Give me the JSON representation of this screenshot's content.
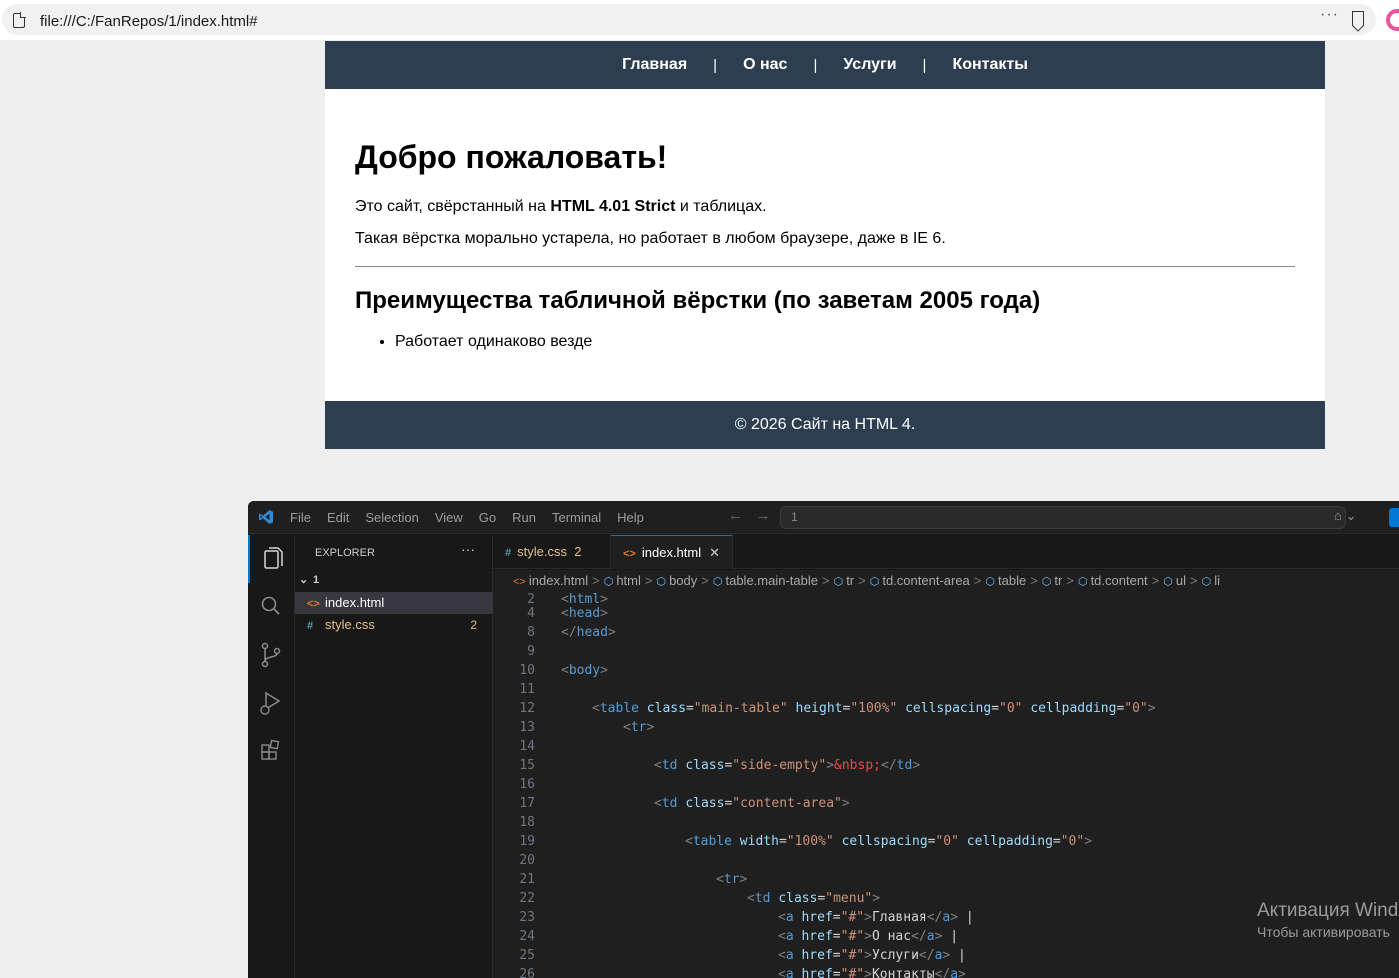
{
  "browser": {
    "url": "file:///C:/FanRepos/1/index.html#"
  },
  "site": {
    "menu": [
      "Главная",
      "О нас",
      "Услуги",
      "Контакты"
    ],
    "menu_sep": "|",
    "heading": "Добро пожаловать!",
    "p1_before": "Это сайт, свёрстанный на ",
    "p1_bold": "HTML 4.01 Strict",
    "p1_after": " и таблицах.",
    "p2": "Такая вёрстка морально устарела, но работает в любом браузере, даже в IE 6.",
    "subheading": "Преимущества табличной вёрстки (по заветам 2005 года)",
    "list": [
      "Работает одинаково везде"
    ],
    "footer": "© 2026 Сайт на HTML 4."
  },
  "vscode": {
    "menus": [
      "File",
      "Edit",
      "Selection",
      "View",
      "Go",
      "Run",
      "Terminal",
      "Help"
    ],
    "command_center": "1",
    "explorer_title": "EXPLORER",
    "folder": "1",
    "files": [
      {
        "name": "index.html",
        "icon": "<>",
        "selected": true,
        "badge": ""
      },
      {
        "name": "style.css",
        "icon": "#",
        "selected": false,
        "badge": "2"
      }
    ],
    "tabs": [
      {
        "name": "style.css",
        "icon": "#",
        "badge": "2",
        "active": false
      },
      {
        "name": "index.html",
        "icon": "<>",
        "active": true
      }
    ],
    "breadcrumbs": [
      "index.html",
      "html",
      "body",
      "table.main-table",
      "tr",
      "td.content-area",
      "table",
      "tr",
      "td.content",
      "ul",
      "li"
    ],
    "code_lines": [
      {
        "n": "2",
        "indent": 0,
        "parts": [
          [
            "br",
            "<"
          ],
          [
            "tag",
            "html"
          ],
          [
            "br",
            ">"
          ]
        ]
      },
      {
        "n": "4",
        "indent": 0,
        "parts": [
          [
            "br",
            "<"
          ],
          [
            "tag",
            "head"
          ],
          [
            "br",
            ">"
          ]
        ]
      },
      {
        "n": "8",
        "indent": 0,
        "parts": [
          [
            "br",
            "</"
          ],
          [
            "tag",
            "head"
          ],
          [
            "br",
            ">"
          ]
        ]
      },
      {
        "n": "9",
        "indent": 0,
        "parts": []
      },
      {
        "n": "10",
        "indent": 0,
        "parts": [
          [
            "br",
            "<"
          ],
          [
            "tag",
            "body"
          ],
          [
            "br",
            ">"
          ]
        ]
      },
      {
        "n": "11",
        "indent": 0,
        "parts": []
      },
      {
        "n": "12",
        "indent": 1,
        "parts": [
          [
            "br",
            "<"
          ],
          [
            "tag",
            "table"
          ],
          [
            "txt",
            " "
          ],
          [
            "attr",
            "class"
          ],
          [
            "txt",
            "="
          ],
          [
            "str",
            "\"main-table\""
          ],
          [
            "txt",
            " "
          ],
          [
            "attr",
            "height"
          ],
          [
            "txt",
            "="
          ],
          [
            "str",
            "\"100%\""
          ],
          [
            "txt",
            " "
          ],
          [
            "attr",
            "cellspacing"
          ],
          [
            "txt",
            "="
          ],
          [
            "str",
            "\"0\""
          ],
          [
            "txt",
            " "
          ],
          [
            "attr",
            "cellpadding"
          ],
          [
            "txt",
            "="
          ],
          [
            "str",
            "\"0\""
          ],
          [
            "br",
            ">"
          ]
        ]
      },
      {
        "n": "13",
        "indent": 2,
        "parts": [
          [
            "br",
            "<"
          ],
          [
            "tag",
            "tr"
          ],
          [
            "br",
            ">"
          ]
        ]
      },
      {
        "n": "14",
        "indent": 0,
        "parts": []
      },
      {
        "n": "15",
        "indent": 3,
        "parts": [
          [
            "br",
            "<"
          ],
          [
            "tag",
            "td"
          ],
          [
            "txt",
            " "
          ],
          [
            "attr",
            "class"
          ],
          [
            "txt",
            "="
          ],
          [
            "str",
            "\"side-empty\""
          ],
          [
            "br",
            ">"
          ],
          [
            "ent",
            "&nbsp;"
          ],
          [
            "br",
            "</"
          ],
          [
            "tag",
            "td"
          ],
          [
            "br",
            ">"
          ]
        ]
      },
      {
        "n": "16",
        "indent": 0,
        "parts": []
      },
      {
        "n": "17",
        "indent": 3,
        "parts": [
          [
            "br",
            "<"
          ],
          [
            "tag",
            "td"
          ],
          [
            "txt",
            " "
          ],
          [
            "attr",
            "class"
          ],
          [
            "txt",
            "="
          ],
          [
            "str",
            "\"content-area\""
          ],
          [
            "br",
            ">"
          ]
        ]
      },
      {
        "n": "18",
        "indent": 0,
        "parts": []
      },
      {
        "n": "19",
        "indent": 4,
        "parts": [
          [
            "br",
            "<"
          ],
          [
            "tag",
            "table"
          ],
          [
            "txt",
            " "
          ],
          [
            "attr",
            "width"
          ],
          [
            "txt",
            "="
          ],
          [
            "str",
            "\"100%\""
          ],
          [
            "txt",
            " "
          ],
          [
            "attr",
            "cellspacing"
          ],
          [
            "txt",
            "="
          ],
          [
            "str",
            "\"0\""
          ],
          [
            "txt",
            " "
          ],
          [
            "attr",
            "cellpadding"
          ],
          [
            "txt",
            "="
          ],
          [
            "str",
            "\"0\""
          ],
          [
            "br",
            ">"
          ]
        ]
      },
      {
        "n": "20",
        "indent": 0,
        "parts": []
      },
      {
        "n": "21",
        "indent": 5,
        "parts": [
          [
            "br",
            "<"
          ],
          [
            "tag",
            "tr"
          ],
          [
            "br",
            ">"
          ]
        ]
      },
      {
        "n": "22",
        "indent": 6,
        "parts": [
          [
            "br",
            "<"
          ],
          [
            "tag",
            "td"
          ],
          [
            "txt",
            " "
          ],
          [
            "attr",
            "class"
          ],
          [
            "txt",
            "="
          ],
          [
            "str",
            "\"menu\""
          ],
          [
            "br",
            ">"
          ]
        ]
      },
      {
        "n": "23",
        "indent": 7,
        "parts": [
          [
            "br",
            "<"
          ],
          [
            "tag",
            "a"
          ],
          [
            "txt",
            " "
          ],
          [
            "attr",
            "href"
          ],
          [
            "txt",
            "="
          ],
          [
            "str",
            "\"#\""
          ],
          [
            "br",
            ">"
          ],
          [
            "txt",
            "Главная"
          ],
          [
            "br",
            "</"
          ],
          [
            "tag",
            "a"
          ],
          [
            "br",
            ">"
          ],
          [
            "txt",
            " |"
          ]
        ]
      },
      {
        "n": "24",
        "indent": 7,
        "parts": [
          [
            "br",
            "<"
          ],
          [
            "tag",
            "a"
          ],
          [
            "txt",
            " "
          ],
          [
            "attr",
            "href"
          ],
          [
            "txt",
            "="
          ],
          [
            "str",
            "\"#\""
          ],
          [
            "br",
            ">"
          ],
          [
            "txt",
            "О нас"
          ],
          [
            "br",
            "</"
          ],
          [
            "tag",
            "a"
          ],
          [
            "br",
            ">"
          ],
          [
            "txt",
            " |"
          ]
        ]
      },
      {
        "n": "25",
        "indent": 7,
        "parts": [
          [
            "br",
            "<"
          ],
          [
            "tag",
            "a"
          ],
          [
            "txt",
            " "
          ],
          [
            "attr",
            "href"
          ],
          [
            "txt",
            "="
          ],
          [
            "str",
            "\"#\""
          ],
          [
            "br",
            ">"
          ],
          [
            "txt",
            "Услуги"
          ],
          [
            "br",
            "</"
          ],
          [
            "tag",
            "a"
          ],
          [
            "br",
            ">"
          ],
          [
            "txt",
            " |"
          ]
        ]
      },
      {
        "n": "26",
        "indent": 7,
        "parts": [
          [
            "br",
            "<"
          ],
          [
            "tag",
            "a"
          ],
          [
            "txt",
            " "
          ],
          [
            "attr",
            "href"
          ],
          [
            "txt",
            "="
          ],
          [
            "str",
            "\"#\""
          ],
          [
            "br",
            ">"
          ],
          [
            "txt",
            "Контакты"
          ],
          [
            "br",
            "</"
          ],
          [
            "tag",
            "a"
          ],
          [
            "br",
            ">"
          ]
        ]
      }
    ]
  },
  "watermark": {
    "line1": "Активация Wind",
    "line2": "Чтобы активировать"
  }
}
